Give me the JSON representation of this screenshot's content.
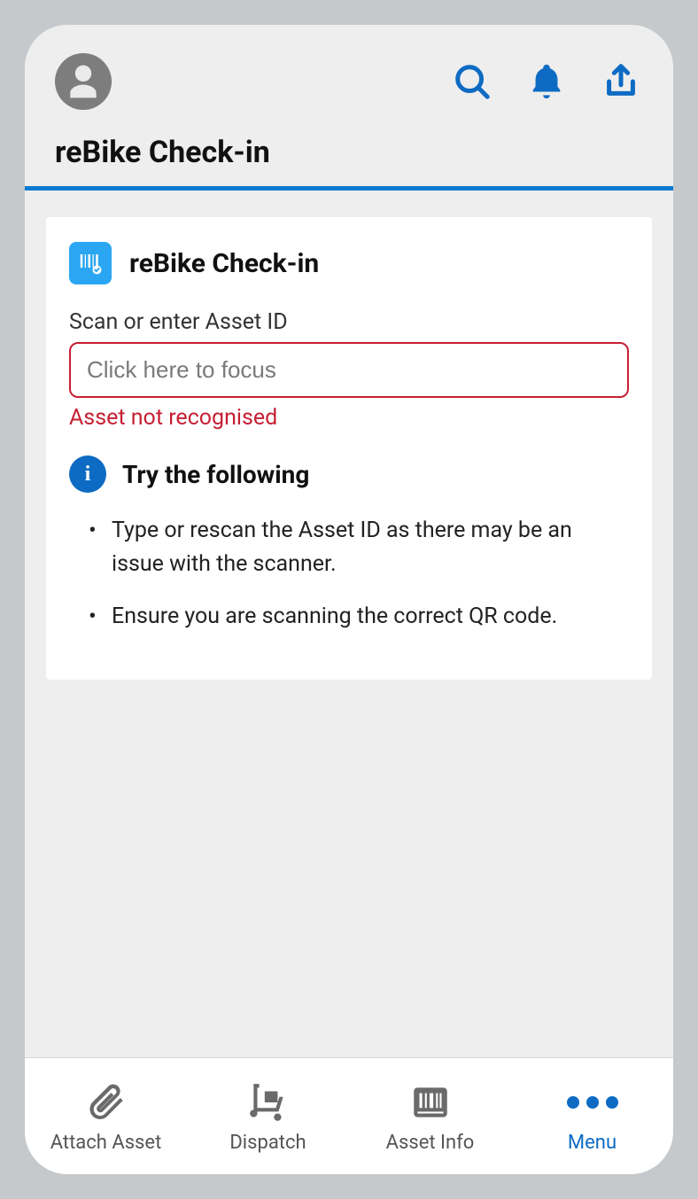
{
  "header": {
    "page_title": "reBike Check-in"
  },
  "card": {
    "title": "reBike Check-in",
    "field_label": "Scan or enter Asset ID",
    "input_placeholder": "Click here to focus",
    "input_value": "",
    "error_text": "Asset not recognised",
    "hint_title": "Try the following",
    "hints": [
      "Type or rescan the Asset ID as there may be an issue with the scanner.",
      "Ensure you are scanning the correct QR code."
    ]
  },
  "bottom_nav": {
    "items": [
      {
        "label": "Attach Asset",
        "icon": "paperclip",
        "active": false
      },
      {
        "label": "Dispatch",
        "icon": "dolly",
        "active": false
      },
      {
        "label": "Asset Info",
        "icon": "barcode-box",
        "active": false
      },
      {
        "label": "Menu",
        "icon": "dots",
        "active": true
      }
    ]
  },
  "colors": {
    "primary": "#0e6bc3",
    "accent": "#2aa6f2",
    "error": "#c62033"
  }
}
